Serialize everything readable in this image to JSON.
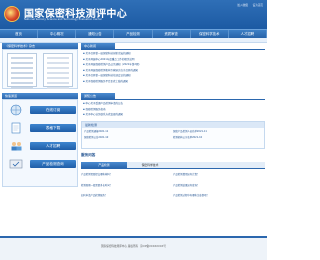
{
  "header": {
    "title": "国家保密科技测评中心",
    "subtitle": "National Secrecy Science and Technology Evaluation Center",
    "top_links": [
      "加入收藏",
      "设为首页"
    ]
  },
  "nav": [
    "首页",
    "中心概况",
    "通知公告",
    "产品检测",
    "资质审查",
    "保密科学技术",
    "人才招聘"
  ],
  "left": {
    "book_panel_title": "《保密科学技术》杂志",
    "services_title": "快速通道",
    "services": [
      "在线订阅",
      "表格下载",
      "人才招聘",
      "产品检测查询"
    ]
  },
  "news": {
    "title": "中心新闻",
    "items": [
      "关于召开第一届保密科技创新论坛的通知",
      "关于开展中心2021年度重点工作的相关说明",
      "关于开展保密检测产品公示通知（2021年第2期）",
      "关于开展保密检测机构专家研究在京召开的通知",
      "关于召开第一届保密科技培训会议的通知",
      "关于保密检测服务平台正式上线的通知"
    ]
  },
  "notices": {
    "title": "通知公告",
    "items": [
      "中心关于受理产品检测申请的公告",
      "保密检测服务指南",
      "关于中心业务联系方式变更的通知"
    ]
  },
  "latest": {
    "title": "最新检测",
    "items": [
      "产品检测通报2021-11",
      "保密产品检测人员名单2021-11",
      "保密检测公告2021-10",
      "检测机构公示名单2021-10"
    ]
  },
  "service": {
    "title": "服务问答",
    "tabs": [
      "产品检测",
      "保密科学技术"
    ],
    "items": [
      "产品检测需要提交哪些材料？",
      "产品检测费用如何计算？",
      "检测周期一般需要多长时间？",
      "产品检测结果如何查询？",
      "如何申请产品检测服务？",
      "产品检测过程中有哪些注意事项？"
    ]
  },
  "footer": {
    "line1": "国家保密科技测评中心 版权所有",
    "line2": "京ICP备XXXXXXXX号"
  }
}
